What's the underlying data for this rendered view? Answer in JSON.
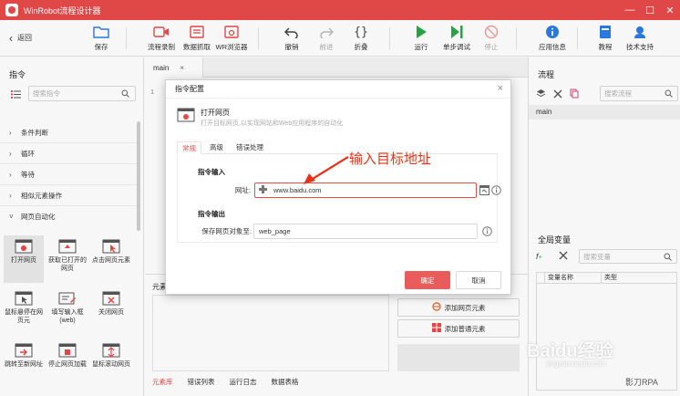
{
  "app": {
    "title": "WinRobot流程设计器",
    "window_controls": [
      "—",
      "☐",
      "✕"
    ]
  },
  "toolbar": {
    "back_label": "返回",
    "save_label": "保存",
    "record_label": "流程录制",
    "capture_label": "数据抓取",
    "browser_label": "WR浏览器",
    "undo_label": "撤销",
    "redo_label": "前进",
    "fold_label": "折叠",
    "run_label": "运行",
    "debug_label": "单步调试",
    "stop_label": "停止",
    "appinfo_label": "应用信息",
    "tutorial_label": "教程",
    "support_label": "技术支持"
  },
  "left_panel": {
    "title": "指令",
    "search_placeholder": "搜索指令",
    "categories": [
      "条件判断",
      "循环",
      "等待",
      "相似元素操作",
      "网页自动化"
    ],
    "tiles": [
      {
        "label": "打开网页"
      },
      {
        "label": "获取已打开的网页"
      },
      {
        "label": "点击网页元素"
      },
      {
        "label": "鼠标悬停在网页元"
      },
      {
        "label": "填写输入框(web)"
      },
      {
        "label": "关闭网页"
      },
      {
        "label": "跳转至新网址"
      },
      {
        "label": "停止网页加载"
      },
      {
        "label": "鼠标滚动网页"
      }
    ]
  },
  "editor": {
    "tab_label": "main",
    "tab_close": "×",
    "line_number": "1"
  },
  "bottom_panel": {
    "title": "元素",
    "add_web_element": "添加网页元素",
    "add_normal_element": "添加普通元素",
    "tabs": [
      "元素库",
      "错误列表",
      "运行日志",
      "数据表格"
    ]
  },
  "right_panel": {
    "flow_title": "流程",
    "flow_search_placeholder": "搜索流程",
    "flow_items": [
      "main"
    ],
    "vars_title": "全局变量",
    "vars_search_placeholder": "搜索变量",
    "vars_columns": [
      "变量名称",
      "类型"
    ]
  },
  "dialog": {
    "title": "指令配置",
    "close": "×",
    "command_name": "打开网页",
    "command_desc": "打开目标网页,以实现网站和Web应用程序的自动化",
    "tabs": [
      "常规",
      "高级",
      "错误处理"
    ],
    "input_section": "指令输入",
    "url_label": "网址:",
    "url_value": "www.baidu.com",
    "output_section": "指令输出",
    "save_label": "保存网页对象至:",
    "save_value": "web_page",
    "ok_label": "确定",
    "cancel_label": "取消"
  },
  "annotation": {
    "text": "输入目标地址"
  },
  "watermarks": {
    "logo": "Baidu经验",
    "url": "jingyan.baidu.com",
    "credit": "影刀RPA"
  },
  "colors": {
    "accent": "#e84a4a",
    "annotation": "#e6331a",
    "toolbar_blue": "#2c7be5",
    "run_green": "#2aa84a"
  }
}
